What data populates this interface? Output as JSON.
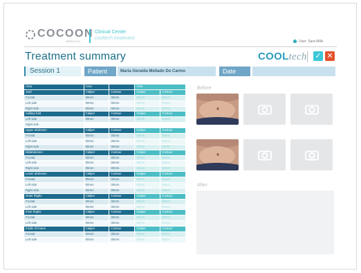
{
  "header": {
    "brand_word": "COCOON",
    "brand_sub": "MEDICAL",
    "clinic_line1": "Clinical Center",
    "clinic_line2": "cooltech treatment",
    "user_label": "User: Sara Mills"
  },
  "page": {
    "title": "Treatment summary",
    "product_logo_main": "COOL",
    "product_logo_tail": "tech",
    "confirm_glyph": "✓",
    "close_glyph": "✕"
  },
  "session": {
    "label": "Session 1",
    "patient_label": "Patient",
    "patient_name": "Maria Geralda Mellado Do Carmo",
    "date_label": "Date",
    "date_value": ""
  },
  "table": {
    "headers": [
      "Area",
      "Area",
      "",
      "Area",
      ""
    ],
    "rows": [
      {
        "type": "grp",
        "cells": [
          "Jowl",
          "Caliper",
          "Contour",
          "Caliper",
          "Contour"
        ]
      },
      {
        "type": "sub0",
        "cells": [
          "Frontal",
          "00mm",
          "00mm",
          "00mm",
          "00mm"
        ]
      },
      {
        "type": "sub1",
        "cells": [
          "Left side",
          "00mm",
          "00mm",
          "00mm",
          "00mm"
        ]
      },
      {
        "type": "sub0",
        "cells": [
          "Right side",
          "00mm",
          "00mm",
          "00mm",
          "00mm"
        ]
      },
      {
        "type": "grp",
        "cells": [
          "Axillary fold",
          "Caliper",
          "Contour",
          "Caliper",
          "Contour"
        ]
      },
      {
        "type": "sub0",
        "cells": [
          "Left side",
          "00mm",
          "00mm",
          "00mm",
          "00mm"
        ]
      },
      {
        "type": "sub1 nodata",
        "cells": [
          "Right side",
          "",
          "",
          "",
          ""
        ]
      },
      {
        "type": "grp",
        "cells": [
          "Upper abdomen",
          "Caliper",
          "Contour",
          "Caliper",
          "Contour"
        ]
      },
      {
        "type": "sub0",
        "cells": [
          "Frontal",
          "00mm",
          "00mm",
          "00mm",
          "00mm"
        ]
      },
      {
        "type": "sub1",
        "cells": [
          "Left side",
          "00mm",
          "00mm",
          "00mm",
          "00mm"
        ]
      },
      {
        "type": "sub0",
        "cells": [
          "Right side",
          "00mm",
          "00mm",
          "00mm",
          "00mm"
        ]
      },
      {
        "type": "grp",
        "cells": [
          "Midabdomen",
          "Caliper",
          "Contour",
          "Caliper",
          "Contour"
        ]
      },
      {
        "type": "sub0",
        "cells": [
          "Frontal",
          "00mm",
          "00mm",
          "00mm",
          "00mm"
        ]
      },
      {
        "type": "sub1",
        "cells": [
          "Left side",
          "00mm",
          "00mm",
          "00mm",
          "00mm"
        ]
      },
      {
        "type": "sub0",
        "cells": [
          "Right side",
          "00mm",
          "00mm",
          "00mm",
          "00mm"
        ]
      },
      {
        "type": "grp",
        "cells": [
          "Lower abdomen",
          "Caliper",
          "Contour",
          "Caliper",
          "Contour"
        ]
      },
      {
        "type": "sub0",
        "cells": [
          "Frontal",
          "00mm",
          "00mm",
          "00mm",
          "00mm"
        ]
      },
      {
        "type": "sub1",
        "cells": [
          "Left side",
          "00mm",
          "00mm",
          "00mm",
          "00mm"
        ]
      },
      {
        "type": "sub0",
        "cells": [
          "Right side",
          "00mm",
          "00mm",
          "00mm",
          "00mm"
        ]
      },
      {
        "type": "grp",
        "cells": [
          "Outer thighs",
          "Caliper",
          "Contour",
          "Caliper",
          "Contour"
        ]
      },
      {
        "type": "sub0",
        "cells": [
          "Frontal",
          "00mm",
          "00mm",
          "00mm",
          "00mm"
        ]
      },
      {
        "type": "sub1",
        "cells": [
          "Left side",
          "00mm",
          "00mm",
          "00mm",
          "00mm"
        ]
      },
      {
        "type": "grp",
        "cells": [
          "Inner thighs",
          "Caliper",
          "Contour",
          "Caliper",
          "Contour"
        ]
      },
      {
        "type": "sub0",
        "cells": [
          "Frontal",
          "00mm",
          "00mm",
          "00mm",
          "00mm"
        ]
      },
      {
        "type": "sub1",
        "cells": [
          "Left side",
          "00mm",
          "00mm",
          "00mm",
          "00mm"
        ]
      },
      {
        "type": "grp",
        "cells": [
          "Inside of knees",
          "Caliper",
          "Contour",
          "Caliper",
          "Contour"
        ]
      },
      {
        "type": "sub0",
        "cells": [
          "Frontal",
          "00mm",
          "00mm",
          "00mm",
          "00mm"
        ]
      },
      {
        "type": "sub1",
        "cells": [
          "Left side",
          "00mm",
          "00mm",
          "00mm",
          "00mm"
        ]
      }
    ]
  },
  "photos": {
    "before_label": "Before",
    "after_label": "After"
  },
  "colors": {
    "accent_teal": "#3cc3cf",
    "header_blue": "#1c6b8d",
    "title_blue": "#1b6f8a",
    "close_red": "#e3522b"
  }
}
